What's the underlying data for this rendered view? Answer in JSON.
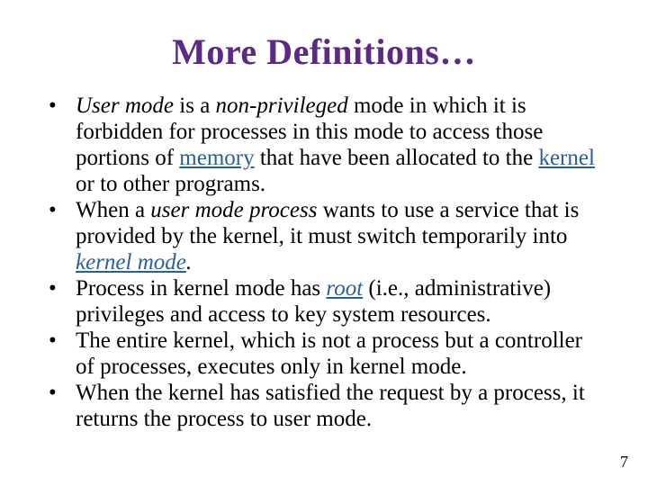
{
  "title": "More Definitions…",
  "page_number": "7",
  "bullets": {
    "b1": {
      "t1": "User mode",
      "t2": " is a ",
      "t3": "non-privileged",
      "t4": " mode in which it is forbidden for processes in this mode to access those portions of ",
      "t5": "memory",
      "t6": " that have been allocated to the ",
      "t7": "kernel",
      "t8": " or to other programs."
    },
    "b2": {
      "t1": "When a ",
      "t2": "user mode process",
      "t3": " wants to use a service that is provided by the kernel, it must switch temporarily into ",
      "t4": "kernel mode",
      "t5": "."
    },
    "b3": {
      "t1": "Process in kernel mode has ",
      "t2": "root",
      "t3": " (i.e., administrative) privileges and access to key system resources."
    },
    "b4": {
      "t1": "The entire kernel, which is not a process but a controller of processes, executes only in kernel mode."
    },
    "b5": {
      "t1": "When the kernel has satisfied the request by a process, it returns the process to user mode."
    }
  }
}
